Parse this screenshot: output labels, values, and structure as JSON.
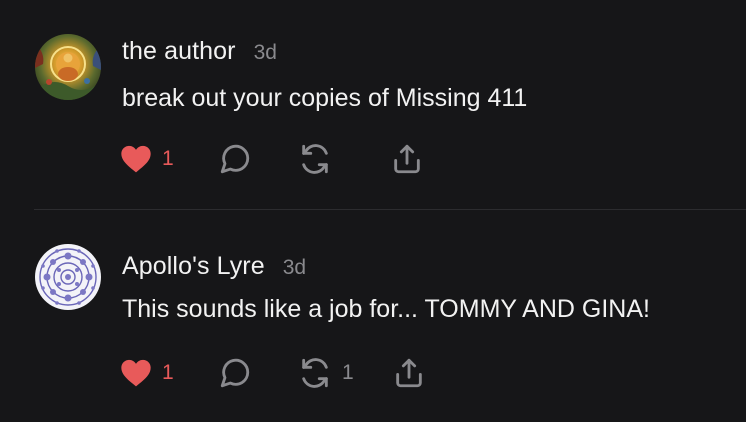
{
  "comments": [
    {
      "author": "the author",
      "time": "3d",
      "text": "break out your copies of Missing 411",
      "likes": "1",
      "restacks": "",
      "liked": true
    },
    {
      "author": "Apollo's Lyre",
      "time": "3d",
      "text": "This sounds like a job for... TOMMY AND GINA!",
      "likes": "1",
      "restacks": "1",
      "liked": true
    }
  ],
  "icons": {
    "like": "heart-icon",
    "reply": "speech-bubble-icon",
    "restack": "restack-arrows-icon",
    "share": "share-upload-icon"
  },
  "colors": {
    "background": "#161618",
    "text": "#f2f2f2",
    "muted": "#8a8a8e",
    "heart": "#e85a5a",
    "divider": "#2c2c2f"
  }
}
